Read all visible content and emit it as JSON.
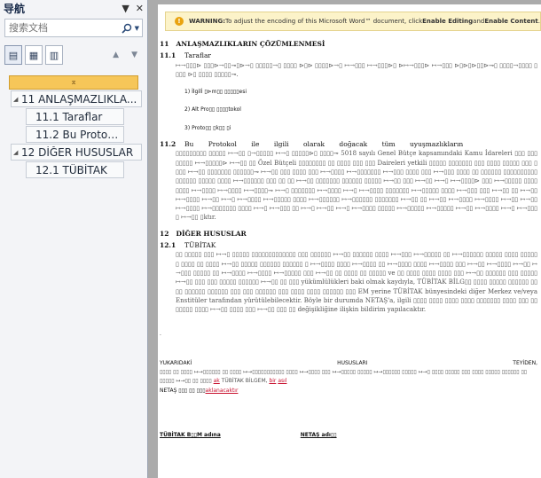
{
  "nav": {
    "title": "导航",
    "dropdown_glyph": "▼",
    "close_glyph": "✕",
    "search_placeholder": "搜索文档",
    "search_icon": "magnifier-icon",
    "tabs": [
      {
        "name": "headings",
        "icon": "headings-view-icon",
        "glyph": "▤",
        "active": true
      },
      {
        "name": "pages",
        "icon": "page-thumbnails-icon",
        "glyph": "▦",
        "active": false
      },
      {
        "name": "results",
        "icon": "search-results-icon",
        "glyph": "▥",
        "active": false
      }
    ],
    "prev_glyph": "▲",
    "next_glyph": "▼",
    "collapse_glyph": "⌅",
    "tree": [
      {
        "label": "11 ANLAŞMAZLIKLA...",
        "level": 1,
        "expandable": true
      },
      {
        "label": "11.1 Taraflar",
        "level": 2
      },
      {
        "label": "11.2 Bu Protokol ...",
        "level": 2
      },
      {
        "label": "12 DİĞER HUSUSLAR",
        "level": 1,
        "expandable": true
      },
      {
        "label": "12.1 TÜBİTAK",
        "level": 2
      }
    ]
  },
  "warning": {
    "prefix": "WARNING:",
    "text1": " To adjust the encoding of this Microsoft Word™ document, click ",
    "enable_editing": "Enable Editing",
    "and": " and ",
    "enable_content": "Enable Content",
    "end": "."
  },
  "doc": {
    "h11_num": "11",
    "h11": "ANLAŞMAZLIKLARIN ÇÖZÜMLENMESİ",
    "s111_num": "11.1",
    "s111": "Taraflar",
    "s111_body": "↦→▯▯▯⊳ ▯▯▯⊳→▯▯⊸▯⊳→▯ ▯▯▯▯▯→▯ ▯▯▯▯ ⊳▯⊳ ▯▯▯▯⊳→▯ ↦→▯▯▯ ↦→▯▯▯⊳▯ ⊳↦→▯▯▯⊳ ↦→▯▯▯ ⊳▯⊳▯⊳▯▯⊳⊸▯ ▯▯▯▯→▯▯▯▯ ▯▯▯▯ ⊳▯ ▯▯▯▯ ▯▯▯▯▯⊸.",
    "list": [
      "1) İlgilİ ▯⊳m▯▯ ▯▯▯▯▯esi",
      "2) Alt Pro▯▯ ▯▯▯▯tokol",
      "3) Proto▯▯ ▯k▯▯ ▯i"
    ],
    "s112_num": "11.2",
    "s112_lead": "Bu Protokol ile ilgili olarak doğacak tüm uyuşmazlıkların",
    "s112_body": "▯▯▯▯▯▯▯▯▯ ▯▯▯▯▯ ↦→▯▯ ▯→▯▯▯▯▯ ↦→▯ ▯▯▯▯▯⊳▯ ▯▯▯▯⊸ 5018 sayılı Genel Bütçe kapsamındaki Kamu İdareleri ▯▯▯ ▯▯▯ ▯▯▯▯▯ ↦→▯▯▯▯▯⊳ ↦→▯▯ ▯▯ Özel Bütçeli ▯▯▯▯▯▯▯▯ ▯▯ ▯▯▯▯ ▯▯▯ ▯▯▯ Daireleri yetkili ▯▯▯▯▯ ▯▯▯▯▯▯▯ ▯▯▯ ▯▯▯▯ ▯▯▯▯▯ ▯▯▯ ▯▯▯▯ ↦→▯▯ ▯▯▯▯▯▯▯ ▯▯▯▯▯▯⊸ ↦→▯▯ ▯▯▯ ▯▯▯▯ ▯▯▯ ↦→▯▯▯▯ ↦→▯▯▯▯▯▯▯ ↦→▯▯▯ ▯▯▯▯ ▯▯▯ ↦→▯▯▯ ▯▯▯▯ ▯▯ ▯▯▯▯▯▯ ▯▯▯▯▯▯▯▯▯▯ ▯▯▯▯▯▯ ▯▯▯▯▯ ▯▯▯▯ ↦→▯▯▯▯▯▯ ▯▯▯ ▯▯ ▯▯ ↦→▯▯ ▯▯▯▯▯▯▯ ▯▯▯▯▯▯ ▯▯▯▯▯ ↦→▯▯ ▯▯▯ ↦→▯▯ ↦→▯ ↦→▯▯▯▯⊳ ▯▯▯ ↦→▯▯▯▯▯ ▯▯▯▯▯▯▯▯ ↦→▯▯▯▯ ↦→▯▯▯▯ ↦→▯▯▯▯⊸ ↦→▯ ▯▯▯▯▯▯▯ ↦→▯▯▯▯ ↦→▯ ↦→▯▯▯▯ ▯▯▯▯▯▯▯ ↦→▯▯▯▯▯ ▯▯▯▯ ↦→▯▯▯ ▯▯▯ ↦→▯▯ ▯▯ ↦→▯▯ ↦→▯▯▯▯ ↦→▯▯ ↦→▯ ↦→▯▯▯▯ ↦→▯▯▯▯▯ ▯▯▯▯ ↦→▯▯▯▯▯▯ ↦→▯▯▯▯▯▯ ▯▯▯▯▯▯▯ ↦→▯▯ ▯▯ ↦→▯▯ ↦→▯▯▯▯ ↦→▯▯▯▯ ↦→▯▯ ↦→▯▯ ↦→▯▯▯▯ ↦→▯▯▯▯▯▯▯ ▯▯▯▯ ↦→▯ ↦→▯▯▯ ▯▯ ↦→▯ ↦→▯▯ ↦→▯ ↦→▯▯▯▯ ▯▯▯▯▯ ↦→▯▯▯▯▯ ↦→▯▯▯▯▯ ↦→▯▯ ↦→▯▯▯▯ ↦→▯ ↦→▯▯▯▯ ↦→▯▯ ▯ktır.",
    "h12_num": "12",
    "h12": "DİĞER HUSUSLAR",
    "s121_num": "12.1",
    "s121": "TÜBİTAK",
    "s121_body": "▯▯ ▯▯▯▯▯ ▯▯▯ ↦→▯ ▯▯▯▯▯ ▯▯▯▯▯▯▯▯▯▯▯▯▯ ▯▯▯ ▯▯▯▯▯▯ ↦→▯▯ ▯▯▯▯▯▯ ▯▯▯▯ ↦→▯▯▯ ↦→▯▯▯▯▯ ▯▯ ↦→▯▯▯▯▯▯ ▯▯▯▯▯ ▯▯▯▯ ▯▯▯▯▯ ▯ ▯▯▯▯ ▯▯ ▯▯▯▯ ↦→▯▯ ▯▯▯▯▯ ▯▯▯▯▯▯ ▯▯▯▯▯▯ ▯ ↦→▯▯▯▯ ▯▯▯▯ ↦→▯▯▯▯ ▯▯ ↦→▯▯▯▯ ▯▯▯▯ ↦→▯▯▯▯ ▯▯▯ ↦→▯▯ ↦→▯▯▯▯ ↦→▯▯ ↦→▯▯▯ ▯▯▯▯▯ ▯▯ ↦→▯▯▯▯ ↦→▯▯▯▯ ↦→▯▯▯▯▯ ▯▯▯ ↦→▯▯ ▯▯ ▯▯▯▯ ▯▯ ▯▯▯▯▯ ve ▯▯ ▯▯▯▯ ▯▯▯▯ ▯▯▯▯ ▯▯▯ ↦→▯▯ ▯▯▯▯▯▯ ▯▯▯ ▯▯▯▯▯ ↦→▯▯ ▯▯▯ ▯▯▯ ▯▯▯▯▯ ▯▯▯▯▯▯ ↦→▯▯ ▯▯ ▯▯▯ yükümlülükleri baki olmak kaydıyla, TÜBİTAK BİLG▯▯ ▯▯▯▯ ▯▯▯▯▯ ▯▯▯▯▯▯ ▯▯▯▯ ▯▯▯▯▯▯ ▯▯▯▯▯▯ ▯▯▯ ▯▯▯ ▯▯▯▯▯▯ ▯▯▯ ▯▯▯▯ ▯▯▯▯ ▯▯▯▯▯▯ ▯▯▯ EM yerine TÜBİTAK bünyesindeki diğer Merkez ve/veya Enstitüler tarafından yürütülebilecektir. Böyle bir durumda NETAŞ'a, ilgili ▯▯▯▯ ▯▯▯▯ ▯▯▯▯ ▯▯▯▯ ▯▯▯▯▯▯▯ ▯▯▯▯ ▯▯▯ ▯▯ ▯▯▯▯▯ ▯▯▯▯ ↦→▯▯ ▯▯▯▯ ▯▯▯ ↦→▯▯ ▯▯▯ ▯▯ değişikliğine ilişkin bildirim yapılacaktır.",
    "marker": ".",
    "yuk_left": "YUKARIDAKİ",
    "yuk_mid": "HUSUSLARI",
    "yuk_right": "TEYİDEN,",
    "yuk_body": "▯▯▯▯ ▯▯ ▯▯▯▯ ↦→▯▯▯▯▯▯ ▯▯ ▯▯▯▯ ↦→▯▯▯▯▯▯▯▯▯▯▯ ▯▯▯▯ ↦→▯▯▯▯ ▯▯▯ ↦→▯▯▯▯▯ ▯▯▯▯▯ ↦→▯▯▯▯▯▯ ▯▯▯▯▯ ↦→▯ ▯▯▯▯ ▯▯▯▯▯ ▯▯▯ ▯▯▯▯ ▯▯▯▯▯ ▯▯▯▯▯▯ ▯▯ ▯▯▯▯▯ ↦→▯▯ ▯▯ ▯▯▯▯",
    "yuk_tail_a": "ak",
    "yuk_tail_b": " TÜBİTAK BİLGEM, ",
    "yuk_tail_c": "bir",
    "yuk_tail_d": "asıl",
    "netas_line_a": "NETAŞ ▯▯▯ ▯▯ ▯▯▯",
    "netas_line_b": "aklanacaktır",
    "sig_left": "TÜBİTAK B▯▯M adına",
    "sig_right": "NETAŞ adı▯▯"
  }
}
